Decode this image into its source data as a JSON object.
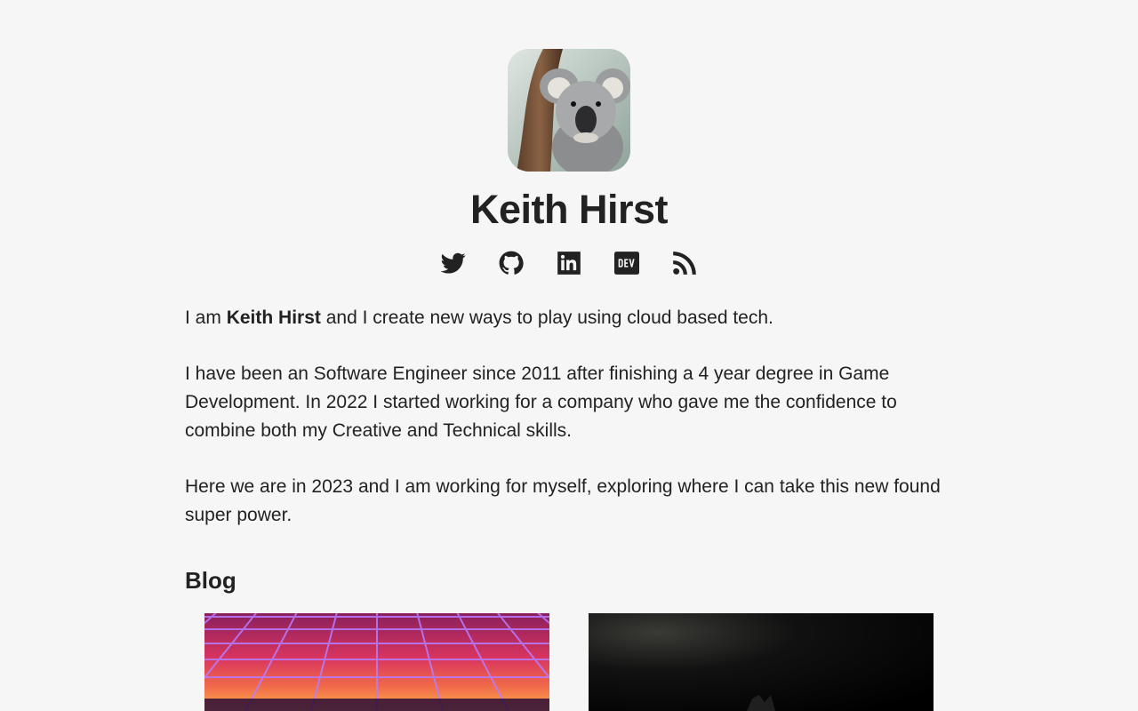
{
  "profile": {
    "name": "Keith Hirst",
    "avatar_alt": "koala-photo"
  },
  "social_links": [
    {
      "name": "twitter",
      "icon": "twitter-icon"
    },
    {
      "name": "github",
      "icon": "github-icon"
    },
    {
      "name": "linkedin",
      "icon": "linkedin-icon"
    },
    {
      "name": "dev",
      "icon": "dev-icon"
    },
    {
      "name": "rss",
      "icon": "rss-icon"
    }
  ],
  "bio": {
    "intro_prefix": "I am",
    "intro_name": "Keith Hirst",
    "intro_suffix": "and I create new ways to play using cloud based tech.",
    "paragraph2": "I have been an Software Engineer since 2011 after finishing a 4 year degree in Game Development. In 2022 I started working for a company who gave me the confidence to combine both my Creative and Technical skills.",
    "paragraph3": "Here we are in 2023 and I am working for myself, exploring where I can take this new found super power."
  },
  "blog": {
    "heading": "Blog"
  },
  "colors": {
    "background": "#f6f6f6",
    "text": "#222222"
  }
}
